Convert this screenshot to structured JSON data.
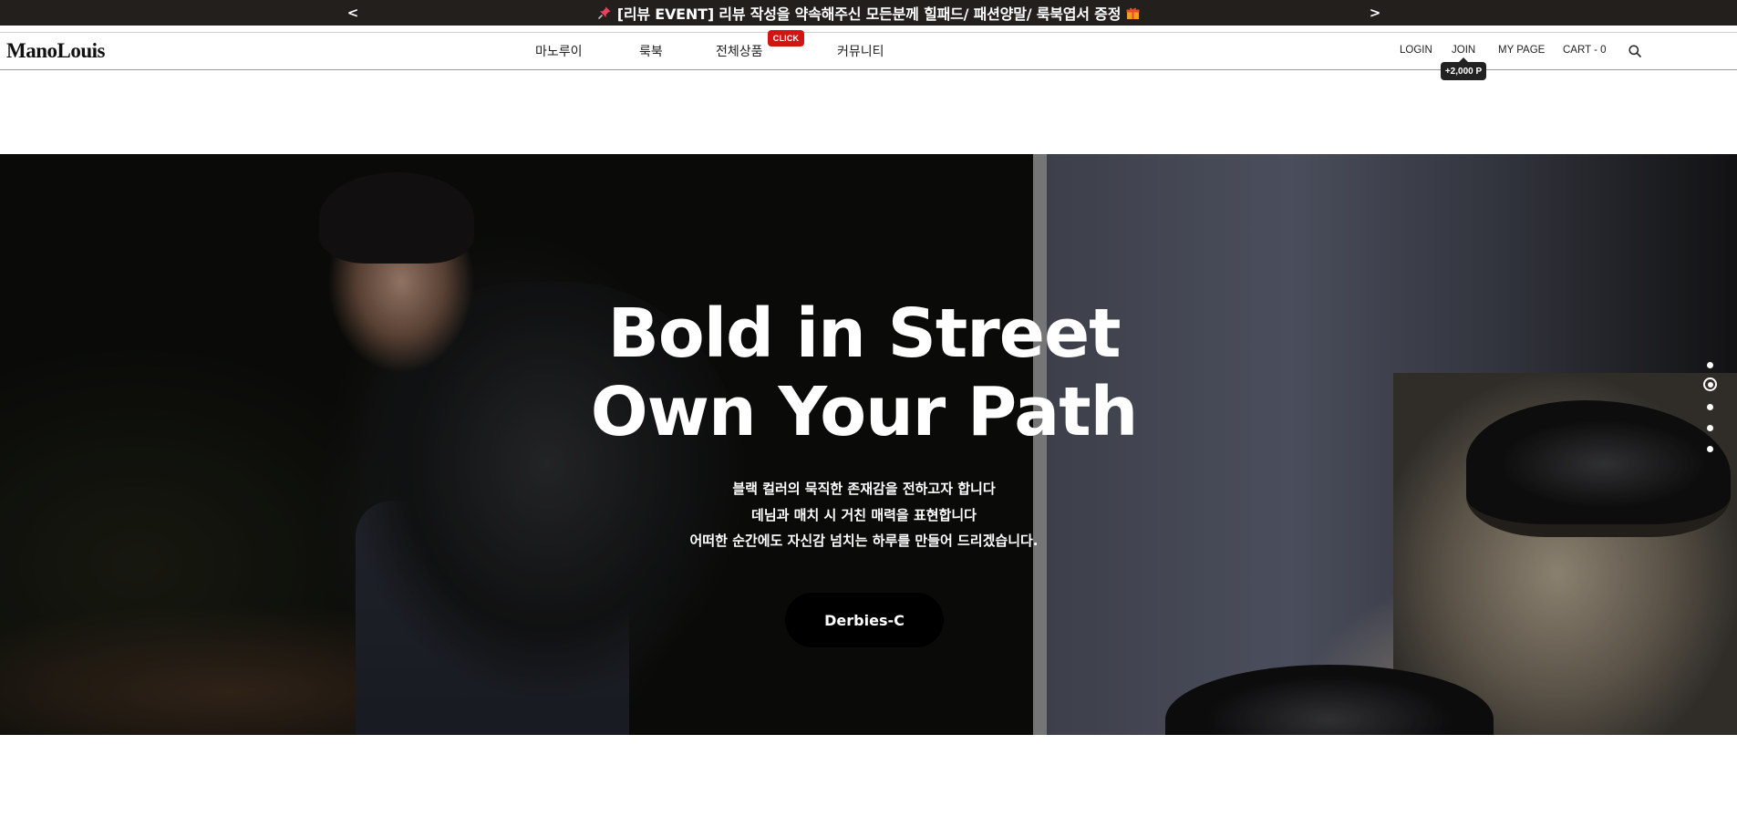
{
  "announcement": {
    "prev_label": "<",
    "next_label": ">",
    "text": "[리뷰 EVENT] 리뷰 작성을 약속해주신 모든분께 힐패드/ 패션양말/ 룩북엽서 증정",
    "leading_icon": "pushpin-icon",
    "trailing_icon": "gift-icon",
    "background": "#231f1c"
  },
  "header": {
    "logo": "ManoLouis",
    "menu": [
      {
        "label": "마노루이"
      },
      {
        "label": "룩북"
      },
      {
        "label": "전체상품"
      },
      {
        "label": "커뮤니티"
      }
    ],
    "menu_badge": "CLICK",
    "badge_color": "#d21414",
    "utility": {
      "login": "LOGIN",
      "join": "JOIN",
      "mypage": "MY PAGE",
      "cart": "CART - 0"
    },
    "join_tooltip": "+2,000 P",
    "search_icon": "search-icon"
  },
  "hero": {
    "title_line1": "Bold in Street",
    "title_line2": "Own Your Path",
    "sub_line1": "블랙 컬러의 묵직한 존재감을 전하고자 합니다",
    "sub_line2": "데님과 매치 시 거친 매력을 표현합니다",
    "sub_line3": "어떠한 순간에도 자신감 넘치는 하루를 만들어 드리겠습니다.",
    "cta_label": "Derbies-C",
    "slides_total": 5,
    "slide_active": 2
  }
}
